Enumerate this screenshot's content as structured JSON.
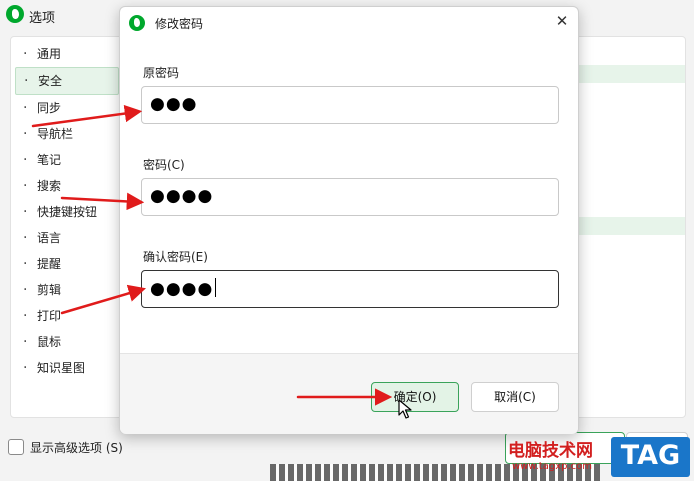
{
  "options_window": {
    "title": "选项",
    "sidebar_items": [
      {
        "label": "通用"
      },
      {
        "label": "安全"
      },
      {
        "label": "同步"
      },
      {
        "label": "导航栏"
      },
      {
        "label": "笔记"
      },
      {
        "label": "搜索"
      },
      {
        "label": "快捷键按钮"
      },
      {
        "label": "语言"
      },
      {
        "label": "提醒"
      },
      {
        "label": "剪辑"
      },
      {
        "label": "打印"
      },
      {
        "label": "鼠标"
      },
      {
        "label": "知识星图"
      }
    ],
    "active_item": "安全",
    "advanced_checkbox_label": "显示高级选项 (S)"
  },
  "dialog": {
    "title": "修改密码",
    "close_glyph": "✕",
    "fields": {
      "old_password": {
        "label": "原密码",
        "value": "●●●"
      },
      "new_password": {
        "label": "密码(C)",
        "value": "●●●●"
      },
      "confirm_password": {
        "label": "确认密码(E)",
        "value": "●●●●"
      }
    },
    "ok_label": "确定(O)",
    "cancel_label": "取消(C)"
  },
  "icons": {
    "app_logo": "evernote-elephant-icon",
    "close": "close-icon",
    "pointer": "mouse-pointer-icon",
    "annotation": "red-arrow-annotation"
  },
  "watermark": {
    "site_name": "电脑技术网",
    "url": "www.tagxp.com",
    "tag": "TAG"
  },
  "colors": {
    "accent_green": "#00a82d",
    "active_bg": "#e7f4ea",
    "arrow_red": "#e01b1b",
    "watermark_blue": "#1a76c9",
    "watermark_red": "#d21f1f"
  }
}
